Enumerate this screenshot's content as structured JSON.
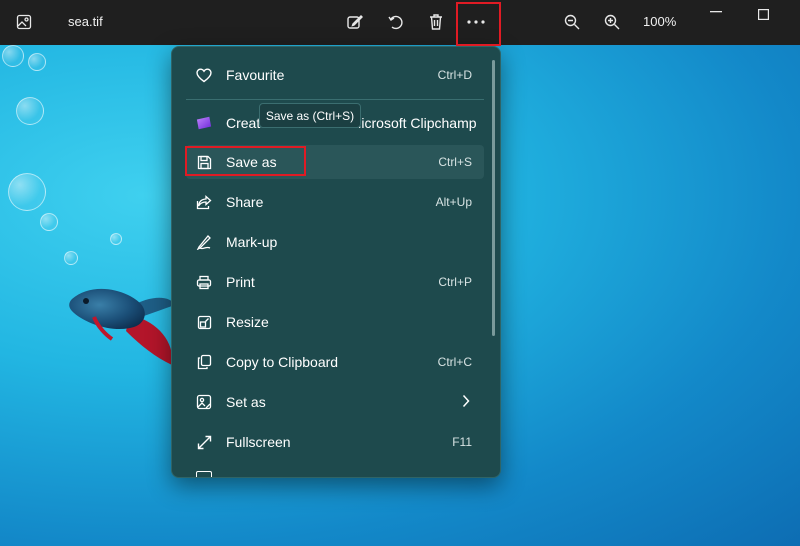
{
  "titlebar": {
    "file_name": "sea.tif",
    "zoom": "100%",
    "icons": [
      "gallery-icon",
      "edit-icon",
      "rotate-icon",
      "delete-icon",
      "more-icon",
      "zoom-out-icon",
      "zoom-in-icon",
      "minimize-icon",
      "maximize-icon"
    ]
  },
  "menu": {
    "items": [
      {
        "label": "Favourite",
        "shortcut": "Ctrl+D",
        "icon": "heart-icon"
      },
      {
        "label": "Create a video with Microsoft Clipchamp",
        "shortcut": "",
        "icon": "clipchamp-icon"
      },
      {
        "label": "Save as",
        "shortcut": "Ctrl+S",
        "icon": "save-icon"
      },
      {
        "label": "Share",
        "shortcut": "Alt+Up",
        "icon": "share-icon"
      },
      {
        "label": "Mark-up",
        "shortcut": "",
        "icon": "markup-icon"
      },
      {
        "label": "Print",
        "shortcut": "Ctrl+P",
        "icon": "print-icon"
      },
      {
        "label": "Resize",
        "shortcut": "",
        "icon": "resize-icon"
      },
      {
        "label": "Copy to Clipboard",
        "shortcut": "Ctrl+C",
        "icon": "copy-icon"
      },
      {
        "label": "Set as",
        "shortcut": "",
        "icon": "set-as-icon"
      },
      {
        "label": "Fullscreen",
        "shortcut": "F11",
        "icon": "fullscreen-icon"
      }
    ]
  },
  "tooltip": {
    "text": "Save as (Ctrl+S)"
  },
  "colors": {
    "titlebar": "#1f1f1f",
    "menu_bg": "#1e4a4d",
    "highlight": "#e01b24",
    "water": "#22b6e2"
  }
}
